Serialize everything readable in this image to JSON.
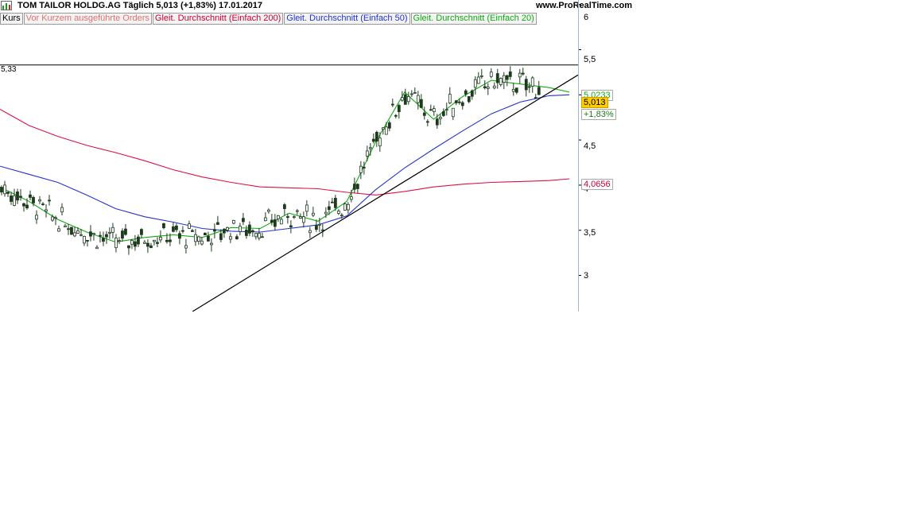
{
  "header": {
    "title": "TOM TAILOR HOLDG.AG   Täglich   5,013 (+1,83%)   17.01.2017",
    "site": "www.ProRealTime.com"
  },
  "legend": [
    {
      "label": "Kurs",
      "color": "#000000"
    },
    {
      "label": "Vor Kurzem ausgeführte Orders",
      "color": "#e07070"
    },
    {
      "label": "Gleit. Durchschnitt (Einfach 200)",
      "color": "#cc0033"
    },
    {
      "label": "Gleit. Durchschnitt (Einfach 50)",
      "color": "#2233cc"
    },
    {
      "label": "Gleit. Durchschnitt (Einfach 20)",
      "color": "#11aa11"
    }
  ],
  "tags": {
    "price": "5,013",
    "change": "+1,83%",
    "ma20": "5,0233",
    "ma200": "4,0656"
  },
  "hline_label": "5,33",
  "chart_data": {
    "type": "candlestick",
    "y_ticks": [
      "6",
      "5,5",
      "5",
      "4,5",
      "4",
      "3,5",
      "3"
    ],
    "ylim": [
      2.6,
      6.05
    ],
    "horizontal_line": 5.33,
    "last_close": 5.013,
    "trendline": {
      "from": [
        0.333,
        2.6
      ],
      "to": [
        1.0,
        5.22
      ]
    },
    "series": [
      {
        "name": "Gleit. Durchschnitt (Einfach 200)",
        "color": "#dd1144",
        "points": [
          [
            0.0,
            4.84
          ],
          [
            0.05,
            4.66
          ],
          [
            0.1,
            4.54
          ],
          [
            0.15,
            4.44
          ],
          [
            0.2,
            4.36
          ],
          [
            0.25,
            4.27
          ],
          [
            0.3,
            4.17
          ],
          [
            0.35,
            4.09
          ],
          [
            0.4,
            4.03
          ],
          [
            0.45,
            3.98
          ],
          [
            0.5,
            3.97
          ],
          [
            0.55,
            3.96
          ],
          [
            0.6,
            3.92
          ],
          [
            0.65,
            3.89
          ],
          [
            0.7,
            3.93
          ],
          [
            0.75,
            3.98
          ],
          [
            0.8,
            4.01
          ],
          [
            0.85,
            4.03
          ],
          [
            0.9,
            4.04
          ],
          [
            0.95,
            4.05
          ],
          [
            0.985,
            4.07
          ]
        ]
      },
      {
        "name": "Gleit. Durchschnitt (Einfach 50)",
        "color": "#2233cc",
        "points": [
          [
            0.0,
            4.21
          ],
          [
            0.05,
            4.12
          ],
          [
            0.1,
            4.03
          ],
          [
            0.15,
            3.89
          ],
          [
            0.2,
            3.74
          ],
          [
            0.25,
            3.65
          ],
          [
            0.3,
            3.59
          ],
          [
            0.35,
            3.52
          ],
          [
            0.4,
            3.49
          ],
          [
            0.45,
            3.48
          ],
          [
            0.5,
            3.52
          ],
          [
            0.55,
            3.56
          ],
          [
            0.6,
            3.66
          ],
          [
            0.65,
            3.95
          ],
          [
            0.7,
            4.19
          ],
          [
            0.75,
            4.4
          ],
          [
            0.8,
            4.6
          ],
          [
            0.85,
            4.79
          ],
          [
            0.9,
            4.92
          ],
          [
            0.95,
            4.99
          ],
          [
            0.985,
            5.0
          ]
        ]
      },
      {
        "name": "Gleit. Durchschnitt (Einfach 20)",
        "color": "#11aa11",
        "points": [
          [
            0.0,
            3.98
          ],
          [
            0.05,
            3.82
          ],
          [
            0.1,
            3.62
          ],
          [
            0.15,
            3.48
          ],
          [
            0.2,
            3.37
          ],
          [
            0.25,
            3.42
          ],
          [
            0.3,
            3.45
          ],
          [
            0.35,
            3.42
          ],
          [
            0.4,
            3.53
          ],
          [
            0.45,
            3.52
          ],
          [
            0.5,
            3.69
          ],
          [
            0.55,
            3.6
          ],
          [
            0.6,
            3.82
          ],
          [
            0.65,
            4.48
          ],
          [
            0.7,
            5.03
          ],
          [
            0.75,
            4.73
          ],
          [
            0.8,
            4.98
          ],
          [
            0.85,
            5.16
          ],
          [
            0.9,
            5.12
          ],
          [
            0.95,
            5.08
          ],
          [
            0.985,
            5.03
          ]
        ]
      }
    ]
  }
}
